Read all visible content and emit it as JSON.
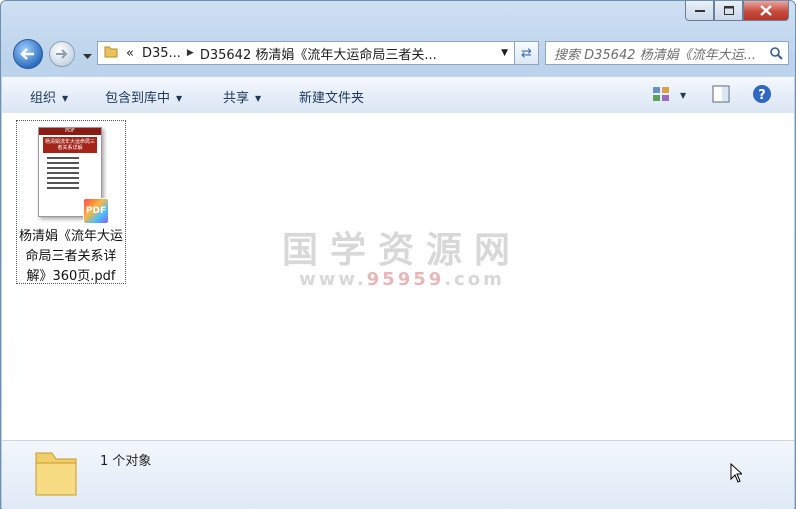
{
  "window": {
    "minimize_label": "minimize",
    "maximize_label": "maximize",
    "close_label": "close"
  },
  "nav": {
    "address": {
      "overflow": "«",
      "seg1": "D35...",
      "seg2": "D35642 杨清娟《流年大运命局三者关..."
    },
    "search": {
      "placeholder": "搜索 D35642 杨清娟《流年大运..."
    }
  },
  "toolbar": {
    "organize": "组织",
    "include_in_library": "包含到库中",
    "share": "共享",
    "new_folder": "新建文件夹"
  },
  "files": [
    {
      "name": "杨清娟《流年大运命局三者关系详解》360页.pdf",
      "thumb_band": "PDF",
      "thumb_title": "杨清娟流年大运命局三者关系详解",
      "badge": "PDF"
    }
  ],
  "watermark": {
    "main": "国学资源网",
    "url_prefix": "www.",
    "url_num": "95959",
    "url_suffix": ".com"
  },
  "status": {
    "count": "1 个对象"
  },
  "colors": {
    "accent": "#2f6fbe",
    "toolbar_text": "#1e395b",
    "close": "#c64a3b"
  }
}
